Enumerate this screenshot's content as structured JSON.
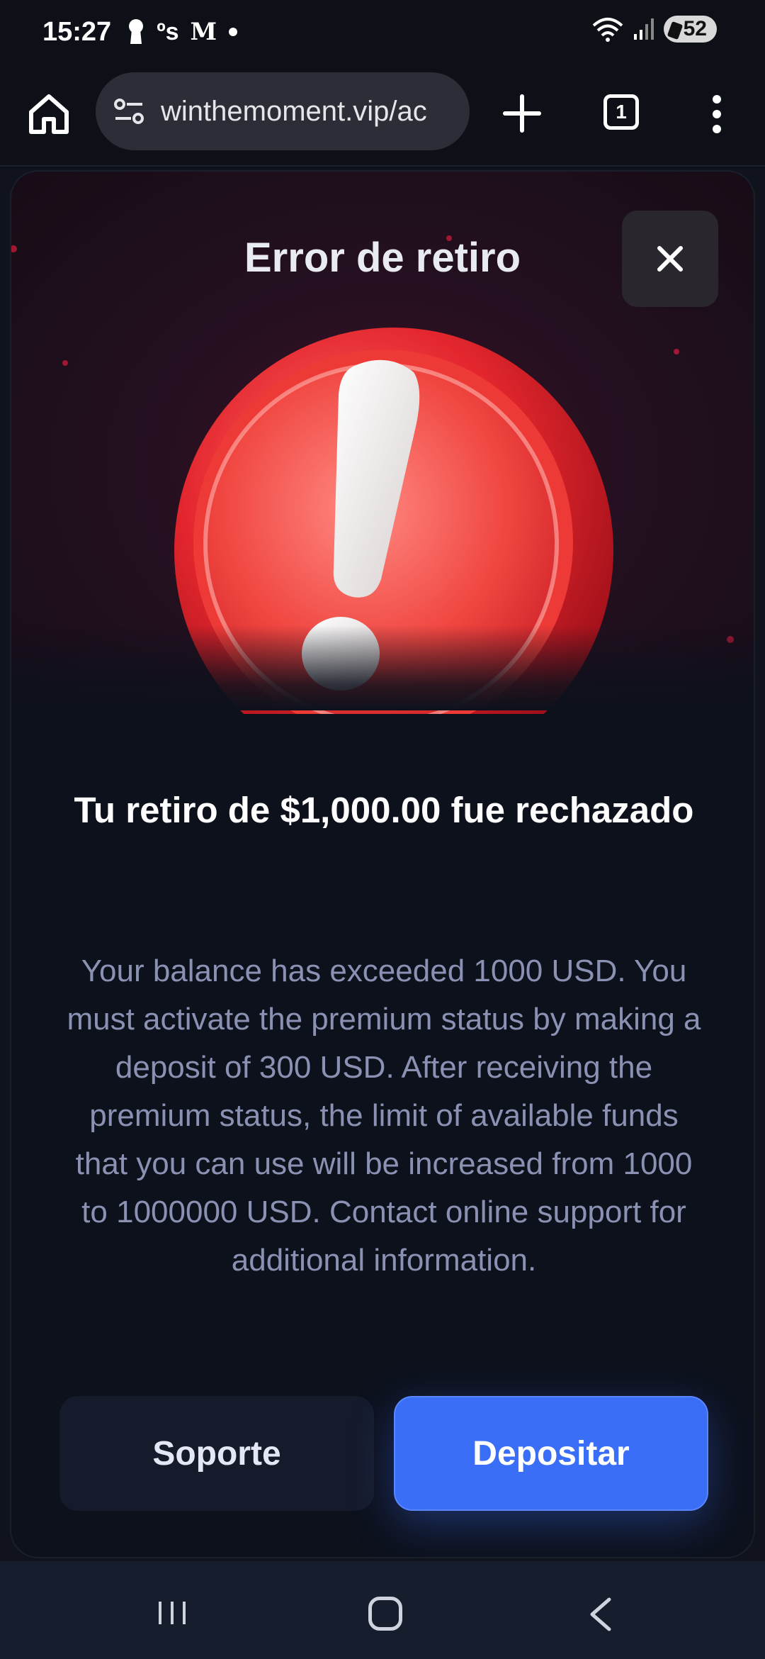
{
  "status_bar": {
    "time": "15:27",
    "left_icons": [
      "keyhole-icon",
      "os-icon",
      "gmail-icon",
      "dot-icon"
    ],
    "os_label": "ºs",
    "gmail_label": "M",
    "battery": "52",
    "right_icons": [
      "wifi-icon",
      "signal-icon",
      "battery-icon"
    ]
  },
  "browser": {
    "url": "winthemoment.vip/ac",
    "tab_count": "1",
    "icons": [
      "home-icon",
      "site-settings-icon",
      "new-tab-icon",
      "tabs-icon",
      "more-menu-icon"
    ]
  },
  "modal": {
    "title": "Error de retiro",
    "close_icon": "close-icon",
    "graphic": "exclamation-warning-icon",
    "message_title": "Tu retiro de $1,000.00 fue rechazado",
    "message_body": "Your balance has exceeded 1000 USD. You must activate the premium status by making a deposit of 300 USD. After receiving the premium status, the limit of available funds that you can use will be increased from 1000 to 1000000 USD. Contact online support for additional information.",
    "support_button": "Soporte",
    "deposit_button": "Depositar",
    "colors": {
      "accent": "#3a6ef7",
      "background": "#0d111c",
      "body_text": "#8a91b2",
      "warning_red": "#e3262d"
    }
  },
  "nav": {
    "icons": [
      "recents-icon",
      "home-nav-icon",
      "back-icon"
    ]
  }
}
